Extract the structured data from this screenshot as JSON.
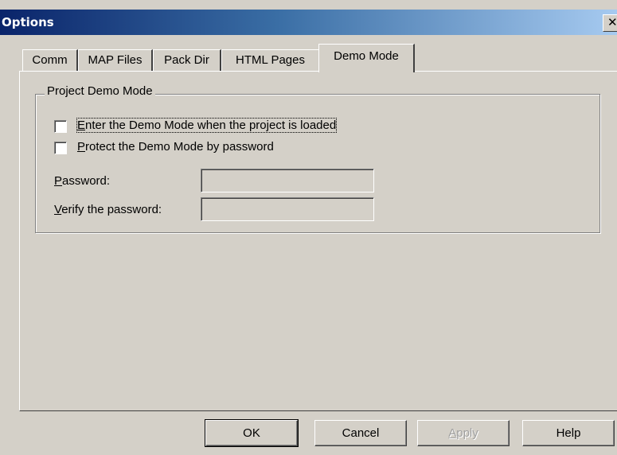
{
  "window": {
    "title": "Options",
    "close_glyph": "✕"
  },
  "tabs": [
    {
      "label": "Comm",
      "active": false
    },
    {
      "label": "MAP Files",
      "active": false
    },
    {
      "label": "Pack Dir",
      "active": false
    },
    {
      "label": "HTML Pages",
      "active": false
    },
    {
      "label": "Demo Mode",
      "active": true
    }
  ],
  "demo_group": {
    "title": "Project Demo Mode",
    "enter_demo_checkbox": {
      "mnemonic": "E",
      "label_rest": "nter the Demo Mode when the project is loaded",
      "checked": false
    },
    "protect_checkbox": {
      "mnemonic": "P",
      "label_rest": "rotect the Demo Mode by password",
      "checked": false
    },
    "password": {
      "mnemonic": "P",
      "label_rest": "assword:",
      "value": ""
    },
    "verify_password": {
      "mnemonic": "V",
      "label_rest": "erify the password:",
      "value": ""
    }
  },
  "buttons": {
    "ok": "OK",
    "cancel": "Cancel",
    "apply_mnemonic": "A",
    "apply_rest": "pply",
    "help": "Help"
  },
  "colors": {
    "face": "#d4d0c8",
    "title_start": "#0a246a",
    "title_end": "#a6caf0"
  }
}
